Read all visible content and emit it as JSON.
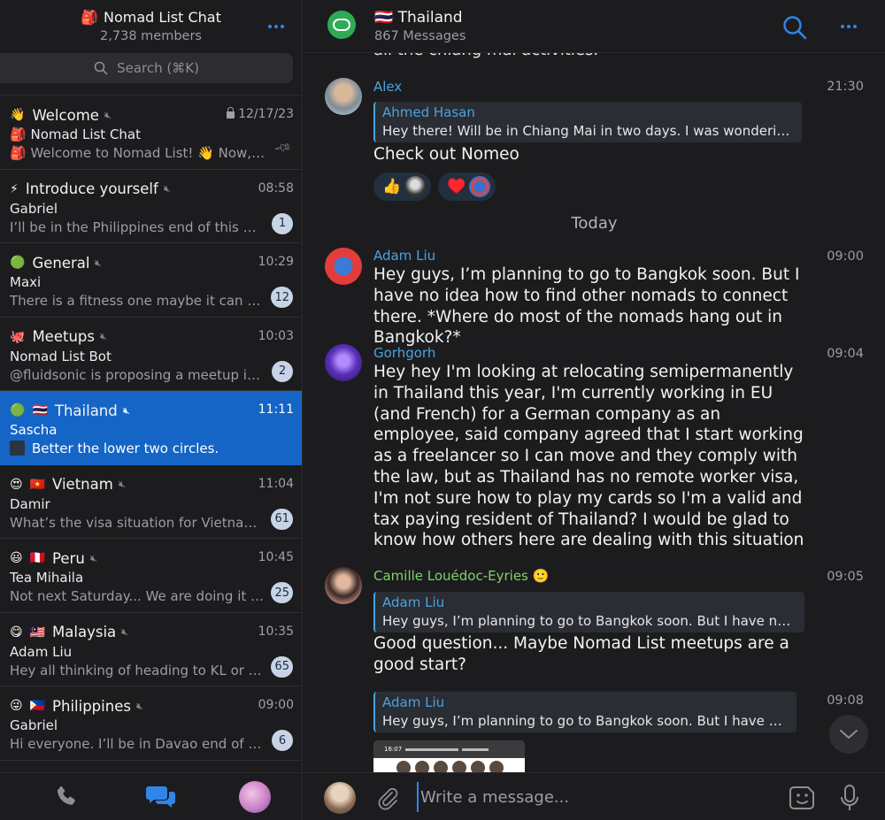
{
  "sidebar": {
    "title": "Nomad List Chat",
    "title_icon": "🎒",
    "members": "2,738 members",
    "search_placeholder": "Search (⌘K)"
  },
  "chats": [
    {
      "emoji": "👋",
      "flag": "",
      "name": "Welcome",
      "time": "12/17/23",
      "sender": "Nomad List Chat",
      "sender_icon": "🎒",
      "preview": "Welcome to Nomad List! 👋 Now, t...",
      "preview_icon": "🎒",
      "badge": "",
      "locked": true,
      "pinned": true
    },
    {
      "emoji": "⚡",
      "flag": "",
      "name": "Introduce yourself",
      "time": "08:58",
      "sender": "Gabriel",
      "preview": "I’ll be in the Philippines end of this mo...",
      "badge": "1"
    },
    {
      "emoji": "🟢",
      "flag": "",
      "name": "General",
      "time": "10:29",
      "sender": "Maxi",
      "preview": "There is a fitness one maybe it can go...",
      "badge": "12"
    },
    {
      "emoji": "🐙",
      "flag": "",
      "name": "Meetups",
      "time": "10:03",
      "sender": "Nomad List Bot",
      "preview": "@fluidsonic is proposing a meetup in B...",
      "badge": "2"
    },
    {
      "emoji": "🟢",
      "flag": "🇹🇭",
      "name": "Thailand",
      "time": "11:11",
      "sender": "Sascha",
      "preview": "Better the lower two circles.",
      "badge": "",
      "active": true
    },
    {
      "emoji": "😍",
      "flag": "🇻🇳",
      "name": "Vietnam",
      "time": "11:04",
      "sender": "Damir",
      "preview": "What’s the visa situation for Vietnam?...",
      "badge": "61"
    },
    {
      "emoji": "😃",
      "flag": "🇵🇪",
      "name": "Peru",
      "time": "10:45",
      "sender": "Tea Mihaila",
      "preview": "Not next Saturday... We are doing it at...",
      "badge": "25"
    },
    {
      "emoji": "😋",
      "flag": "🇲🇾",
      "name": "Malaysia",
      "time": "10:35",
      "sender": "Adam Liu",
      "preview": "Hey all thinking of heading to KL or Pe...",
      "badge": "65"
    },
    {
      "emoji": "😜",
      "flag": "🇵🇭",
      "name": "Philippines",
      "time": "09:00",
      "sender": "Gabriel",
      "preview": "Hi everyone. I’ll be in Davao end of this...",
      "badge": "6"
    }
  ],
  "channel": {
    "flag": "🇹🇭",
    "title": "Thailand",
    "subtitle": "867 Messages"
  },
  "messages": {
    "cut_off_text": "all the chiang mai activities.",
    "alex": {
      "sender": "Alex",
      "time": "21:30",
      "reply_name": "Ahmed Hasan",
      "reply_text": "Hey there! Will be in Chiang Mai in two days. I was wondering if...",
      "text": "Check out Nomeo",
      "reaction1": "👍",
      "reaction2": "♥️"
    },
    "day_separator": "Today",
    "adam": {
      "sender": "Adam Liu",
      "time": "09:00",
      "text": "Hey guys, I’m planning to go to Bangkok soon. But I have no idea how to find other nomads to connect there. *Where do most of the nomads hang out in Bangkok?*"
    },
    "gorhgorh": {
      "sender": "Gorhgorh",
      "time": "09:04",
      "text": "Hey hey I'm looking at relocating semipermanently in Thailand this year, I'm currently working in EU (and French) for a German company as an employee, said company agreed that I start working as a freelancer so I can move and they comply with the law, but as Thailand has no remote worker visa, I'm not sure how to play my cards so I'm a valid and tax paying resident of Thailand? I would be glad to know how others here are dealing with this situation"
    },
    "camille": {
      "sender": "Camille Louédoc-Eyries",
      "sender_emoji": "🙂",
      "time": "09:05",
      "reply_name": "Adam Liu",
      "reply_text": "Hey guys, I’m planning to go to Bangkok soon. But I have no ide...",
      "text": "Good question... Maybe Nomad List meetups are a good start?"
    },
    "camille2": {
      "time": "09:08",
      "reply_name": "Adam Liu",
      "reply_text": "Hey guys, I’m planning to go to Bangkok soon. But I have no id...",
      "image_status": "16:07"
    }
  },
  "composer": {
    "placeholder": "Write a message..."
  },
  "colors": {
    "accent": "#2f86e8",
    "active_row": "#1565c7",
    "alex_name": "#4aa3df",
    "adam_name": "#4aa3df",
    "gorhgorh_name": "#4aa3df",
    "camille_name": "#7ed36a"
  }
}
